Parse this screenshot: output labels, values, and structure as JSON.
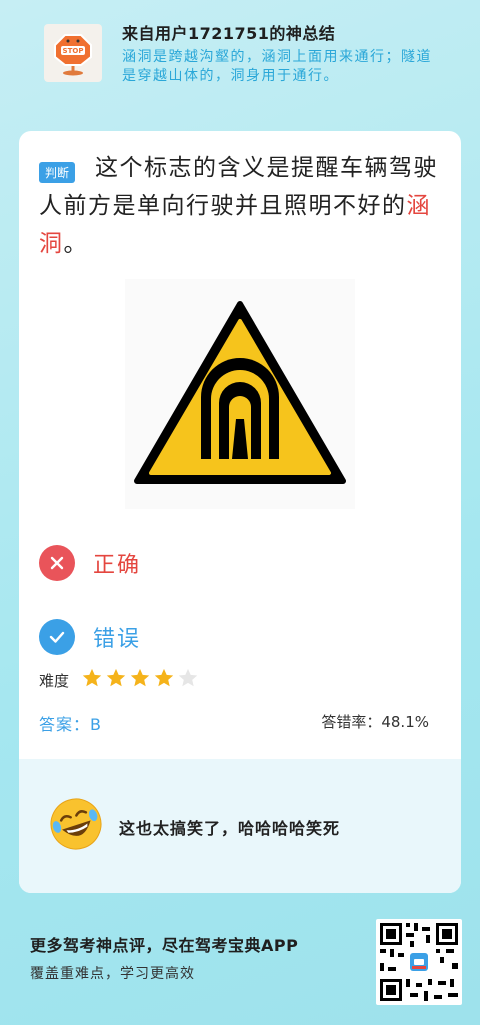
{
  "header": {
    "username": "来自用户1721751的神总结",
    "summary": "涵洞是跨越沟壑的，涵洞上面用来通行；隧道是穿越山体的，洞身用于通行。"
  },
  "question": {
    "tag": "判断",
    "text_before": "这个标志的含义是提醒车辆驾驶人前方是单向行驶并且照明不好的",
    "highlight": "涵洞",
    "text_after": "。"
  },
  "options": [
    {
      "label": "正确",
      "state": "wrong",
      "color": "#e4463f"
    },
    {
      "label": "错误",
      "state": "correct",
      "color": "#3ba0e6"
    }
  ],
  "difficulty": {
    "label": "难度",
    "rating": 4,
    "max": 5
  },
  "answer": {
    "label": "答案：B"
  },
  "error_rate": {
    "label": "答错率：48.1%"
  },
  "comment": {
    "text": "这也太搞笑了，哈哈哈哈笑死",
    "icon": "laughing-emoji"
  },
  "footer": {
    "title": "更多驾考神点评，尽在驾考宝典APP",
    "subtitle": "覆盖重难点，学习更高效"
  },
  "colors": {
    "accent": "#3ba0e6",
    "error": "#e4463f",
    "star": "#f5b31b",
    "sign_yellow": "#f6c41c"
  }
}
